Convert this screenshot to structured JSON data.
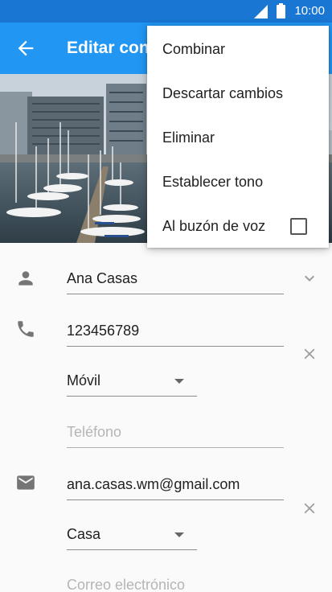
{
  "status_bar": {
    "time": "10:00",
    "signal_icon": "signal-icon",
    "battery_icon": "battery-icon"
  },
  "app_bar": {
    "title": "Editar contacto",
    "back_icon": "back-arrow-icon",
    "color": "#2196f3"
  },
  "overflow_menu": {
    "items": [
      {
        "label": "Combinar"
      },
      {
        "label": "Descartar cambios"
      },
      {
        "label": "Eliminar"
      },
      {
        "label": "Establecer tono"
      },
      {
        "label": "Al buzón de voz",
        "checkbox": true,
        "checked": false
      }
    ]
  },
  "form": {
    "name": {
      "value": "Ana Casas",
      "icon": "person-icon",
      "expand_icon": "chevron-down-icon"
    },
    "phone": {
      "value": "123456789",
      "type": "Móvil",
      "icon": "phone-icon",
      "new_placeholder": "Teléfono",
      "clear_icon": "close-icon"
    },
    "email": {
      "value": "ana.casas.wm@gmail.com",
      "type": "Casa",
      "icon": "email-icon",
      "new_placeholder": "Correo electrónico",
      "clear_icon": "close-icon"
    }
  }
}
